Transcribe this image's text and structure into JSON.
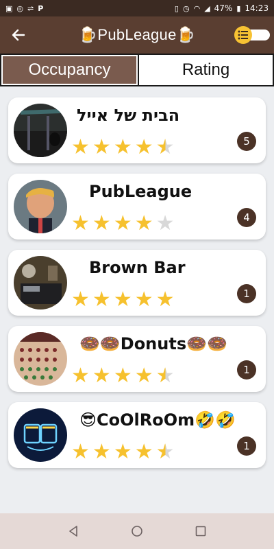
{
  "status_bar": {
    "time": "14:23",
    "battery": "47%",
    "left_icons": [
      "image-icon",
      "whatsapp-icon",
      "usb-icon",
      "p-icon"
    ],
    "left_glyphs": [
      "▣",
      "◎",
      "⇌",
      "P"
    ],
    "right_icons": [
      "vibrate-icon",
      "alarm-icon",
      "wifi-icon",
      "signal-icon",
      "battery-icon"
    ],
    "right_glyphs": [
      "▯",
      "◷",
      "◠",
      "◢",
      "▮"
    ]
  },
  "app_bar": {
    "title": "🍺PubLeague🍺",
    "back_icon": "arrow-left-icon",
    "toggle_icon": "list-icon"
  },
  "tabs": {
    "occupancy": "Occupancy",
    "rating": "Rating",
    "active": "occupancy"
  },
  "places": [
    {
      "name": "הבית של אייל",
      "rating": 4.5,
      "count": "5"
    },
    {
      "name": "PubLeague",
      "rating": 4,
      "count": "4"
    },
    {
      "name": "Brown Bar",
      "rating": 5,
      "count": "1"
    },
    {
      "name": "🍩🍩Donuts🍩🍩",
      "rating": 4.5,
      "count": "1"
    },
    {
      "name": "😎CoOlRoOm🤣🤣",
      "rating": 4.5,
      "count": "1"
    }
  ],
  "nav_bar": {
    "back_icon": "nav-back-icon",
    "home_icon": "nav-home-icon",
    "recents_icon": "nav-recents-icon"
  },
  "colors": {
    "status_bar": "#3b2a22",
    "app_bar": "#5a3e31",
    "tab_active": "#7a5b4e",
    "star": "#f6c12e",
    "badge": "#4b3226",
    "toggle": "#f7c233"
  }
}
